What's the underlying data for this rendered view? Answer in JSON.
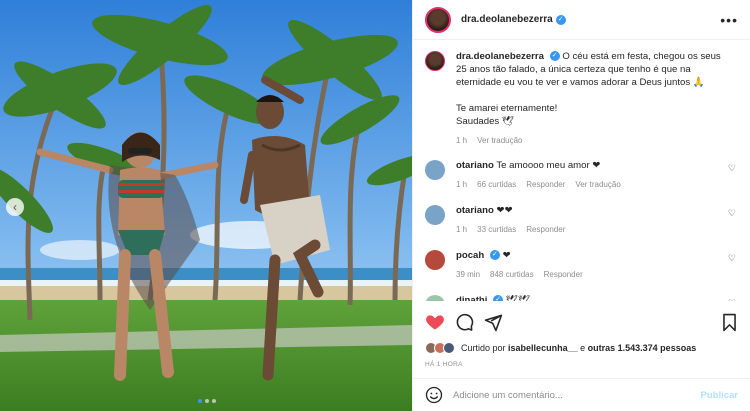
{
  "post": {
    "username": "dra.deolanebezerra",
    "more_icon": "more-horizontal-icon"
  },
  "caption": {
    "username": "dra.deolanebezerra",
    "text": "O céu está em festa, chegou os seus 25 anos tão falado, a única certeza que tenho é que na eternidade eu vou te ver e vamos adorar a Deus juntos 🙏",
    "line2": "Te amarei eternamente!",
    "line3": "Saudades 🕊",
    "time": "1 h",
    "translate": "Ver tradução"
  },
  "comments": [
    {
      "username": "otariano",
      "text": "Te amoooo meu amor ❤",
      "time": "1 h",
      "likes": "66 curtidas",
      "reply": "Responder",
      "translate": "Ver tradução"
    },
    {
      "username": "otariano",
      "text": "❤❤",
      "time": "1 h",
      "likes": "33 curtidas",
      "reply": "Responder"
    },
    {
      "username": "pocah",
      "text": "❤",
      "time": "39 min",
      "likes": "848 curtidas",
      "reply": "Responder"
    },
    {
      "username": "djnathi",
      "text": "🕊🕊"
    }
  ],
  "likes": {
    "prefix": "Curtido por",
    "user": "isabellecunha__",
    "middle": "e",
    "others": "outras 1.543.374 pessoas"
  },
  "timestamp": "HÁ 1 HORA",
  "add_comment": {
    "placeholder": "Adicione um comentário...",
    "publish": "Publicar"
  },
  "colors": {
    "accent": "#3897f0",
    "like": "#ed4956",
    "publish_disabled": "#b2dffc"
  }
}
